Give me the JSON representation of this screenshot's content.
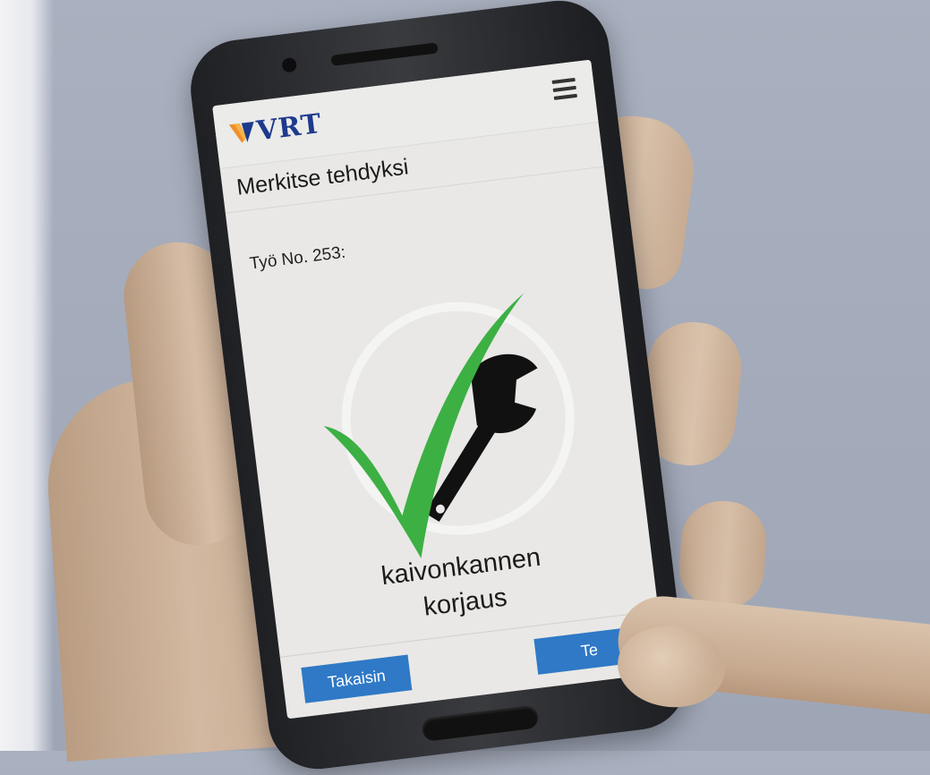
{
  "app": {
    "logo_text": "VRT",
    "brand_color": "#1d3a8c",
    "logo_accent_color": "#f0902a"
  },
  "header": {
    "menu_icon": "hamburger-menu-icon"
  },
  "page": {
    "title": "Merkitse tehdyksi",
    "job_label": "Työ No. 253:",
    "task_line1": "kaivonkannen",
    "task_line2": "korjaus"
  },
  "buttons": {
    "back_label": "Takaisin",
    "done_label": "Te",
    "button_color": "#2f79c6"
  },
  "icons": {
    "status": "checkmark-icon",
    "task": "wrench-icon",
    "check_color": "#3cb043"
  }
}
